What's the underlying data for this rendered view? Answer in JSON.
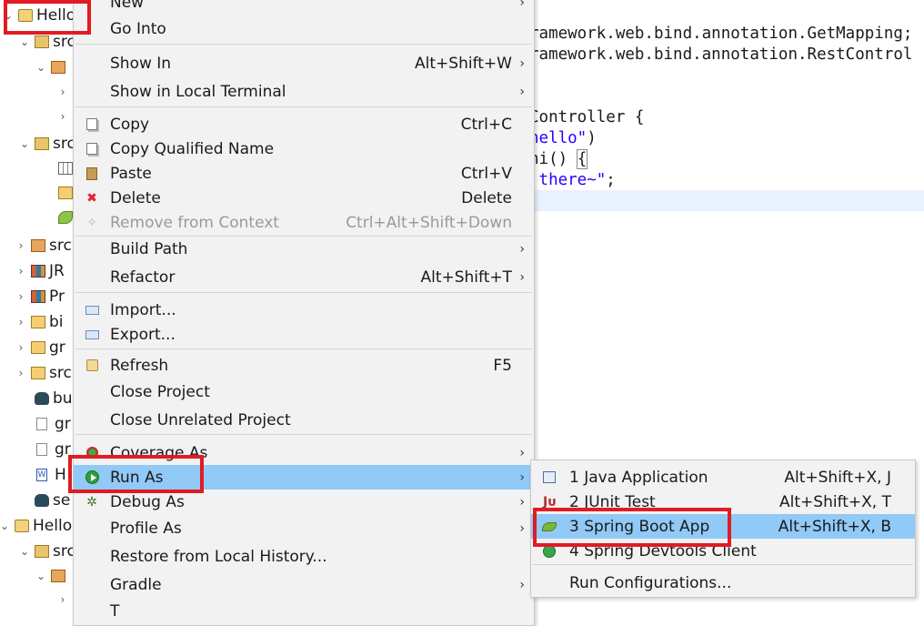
{
  "explorer": {
    "rows": [
      {
        "label": "Hello",
        "twisty": "⌄",
        "icon": "project-icon"
      },
      {
        "label": "src",
        "twisty": "⌄",
        "icon": "source-folder-icon"
      },
      {
        "label": "",
        "twisty": "⌄",
        "icon": "package-icon"
      },
      {
        "label": "",
        "twisty": "›",
        "icon": ""
      },
      {
        "label": "",
        "twisty": "›",
        "icon": ""
      },
      {
        "label": "src",
        "twisty": "⌄",
        "icon": "source-folder-icon"
      },
      {
        "label": "",
        "twisty": "",
        "icon": "grid-icon"
      },
      {
        "label": "",
        "twisty": "",
        "icon": "folder-icon"
      },
      {
        "label": "",
        "twisty": "",
        "icon": "spring-leaf-icon"
      },
      {
        "label": "src",
        "twisty": "›",
        "icon": "source-folder-icon"
      },
      {
        "label": "JR",
        "twisty": "›",
        "icon": "library-icon"
      },
      {
        "label": "Pr",
        "twisty": "›",
        "icon": "library-icon"
      },
      {
        "label": "bi",
        "twisty": "›",
        "icon": "folder-icon"
      },
      {
        "label": "gr",
        "twisty": "›",
        "icon": "folder-icon"
      },
      {
        "label": "src",
        "twisty": "›",
        "icon": "source-folder-icon"
      },
      {
        "label": "bu",
        "twisty": "",
        "icon": "gradle-icon"
      },
      {
        "label": "gr",
        "twisty": "",
        "icon": "file-icon"
      },
      {
        "label": "gr",
        "twisty": "",
        "icon": "file-icon"
      },
      {
        "label": "H",
        "twisty": "",
        "icon": "word-file-icon"
      },
      {
        "label": "se",
        "twisty": "",
        "icon": "gradle-icon"
      },
      {
        "label": "Hello",
        "twisty": "⌄",
        "icon": "project-icon"
      },
      {
        "label": "src",
        "twisty": "⌄",
        "icon": "source-folder-icon"
      },
      {
        "label": "",
        "twisty": "⌄",
        "icon": "package-icon"
      },
      {
        "label": "",
        "twisty": "›",
        "icon": ""
      }
    ]
  },
  "editor": {
    "lines": [
      {
        "text": "ramework.web.bind.annotation.GetMapping;"
      },
      {
        "text": "ramework.web.bind.annotation.RestControl"
      },
      {
        "text": "Controller {"
      }
    ],
    "mapping_string": "hello\"",
    "mapping_close": ")",
    "method_text": "hi() ",
    "open_brace": "{",
    "return_string": " there~\"",
    "semicolon": ";"
  },
  "context_menu": {
    "items": [
      {
        "label": "New",
        "accel": "",
        "submenu": true,
        "icon": ""
      },
      {
        "label": "Go Into",
        "accel": "",
        "submenu": false,
        "icon": ""
      },
      {
        "label": "Show In",
        "accel": "Alt+Shift+W",
        "submenu": true,
        "icon": ""
      },
      {
        "label": "Show in Local Terminal",
        "accel": "",
        "submenu": true,
        "icon": ""
      },
      {
        "label": "Copy",
        "accel": "Ctrl+C",
        "submenu": false,
        "icon": "copy-icon"
      },
      {
        "label": "Copy Qualified Name",
        "accel": "",
        "submenu": false,
        "icon": "copy-qualified-name-icon"
      },
      {
        "label": "Paste",
        "accel": "Ctrl+V",
        "submenu": false,
        "icon": "paste-icon"
      },
      {
        "label": "Delete",
        "accel": "Delete",
        "submenu": false,
        "icon": "delete-icon"
      },
      {
        "label": "Remove from Context",
        "accel": "Ctrl+Alt+Shift+Down",
        "submenu": false,
        "icon": "remove-from-context-icon",
        "disabled": true
      },
      {
        "label": "Build Path",
        "accel": "",
        "submenu": true,
        "icon": ""
      },
      {
        "label": "Refactor",
        "accel": "Alt+Shift+T",
        "submenu": true,
        "icon": ""
      },
      {
        "label": "Import...",
        "accel": "",
        "submenu": false,
        "icon": "import-icon"
      },
      {
        "label": "Export...",
        "accel": "",
        "submenu": false,
        "icon": "export-icon"
      },
      {
        "label": "Refresh",
        "accel": "F5",
        "submenu": false,
        "icon": "refresh-icon"
      },
      {
        "label": "Close Project",
        "accel": "",
        "submenu": false,
        "icon": ""
      },
      {
        "label": "Close Unrelated Project",
        "accel": "",
        "submenu": false,
        "icon": ""
      },
      {
        "label": "Coverage As",
        "accel": "",
        "submenu": true,
        "icon": "coverage-icon"
      },
      {
        "label": "Run As",
        "accel": "",
        "submenu": true,
        "icon": "run-icon",
        "selected": true
      },
      {
        "label": "Debug As",
        "accel": "",
        "submenu": true,
        "icon": "debug-icon"
      },
      {
        "label": "Profile As",
        "accel": "",
        "submenu": true,
        "icon": ""
      },
      {
        "label": "Restore from Local History...",
        "accel": "",
        "submenu": false,
        "icon": ""
      },
      {
        "label": "Gradle",
        "accel": "",
        "submenu": true,
        "icon": ""
      },
      {
        "label": "T",
        "accel": "",
        "submenu": false,
        "icon": ""
      }
    ]
  },
  "run_as_submenu": {
    "items": [
      {
        "label": "1 Java Application",
        "accel": "Alt+Shift+X, J",
        "icon": "java-application-icon"
      },
      {
        "label": "2 JUnit Test",
        "accel": "Alt+Shift+X, T",
        "icon": "junit-icon",
        "icon_text": "Jᴜ"
      },
      {
        "label": "3 Spring Boot App",
        "accel": "Alt+Shift+X, B",
        "icon": "spring-boot-icon",
        "selected": true
      },
      {
        "label": "4 Spring Devtools Client",
        "accel": "",
        "icon": "devtools-icon"
      },
      {
        "label": "Run Configurations...",
        "accel": "",
        "icon": ""
      }
    ]
  },
  "glyphs": {
    "submenu_arrow": "›",
    "delete": "✖",
    "debug": "✲"
  },
  "colors": {
    "selection": "#91c9f7",
    "annotation": "#e01b24",
    "menu_bg": "#f2f2f2",
    "string": "#2a00ff"
  }
}
